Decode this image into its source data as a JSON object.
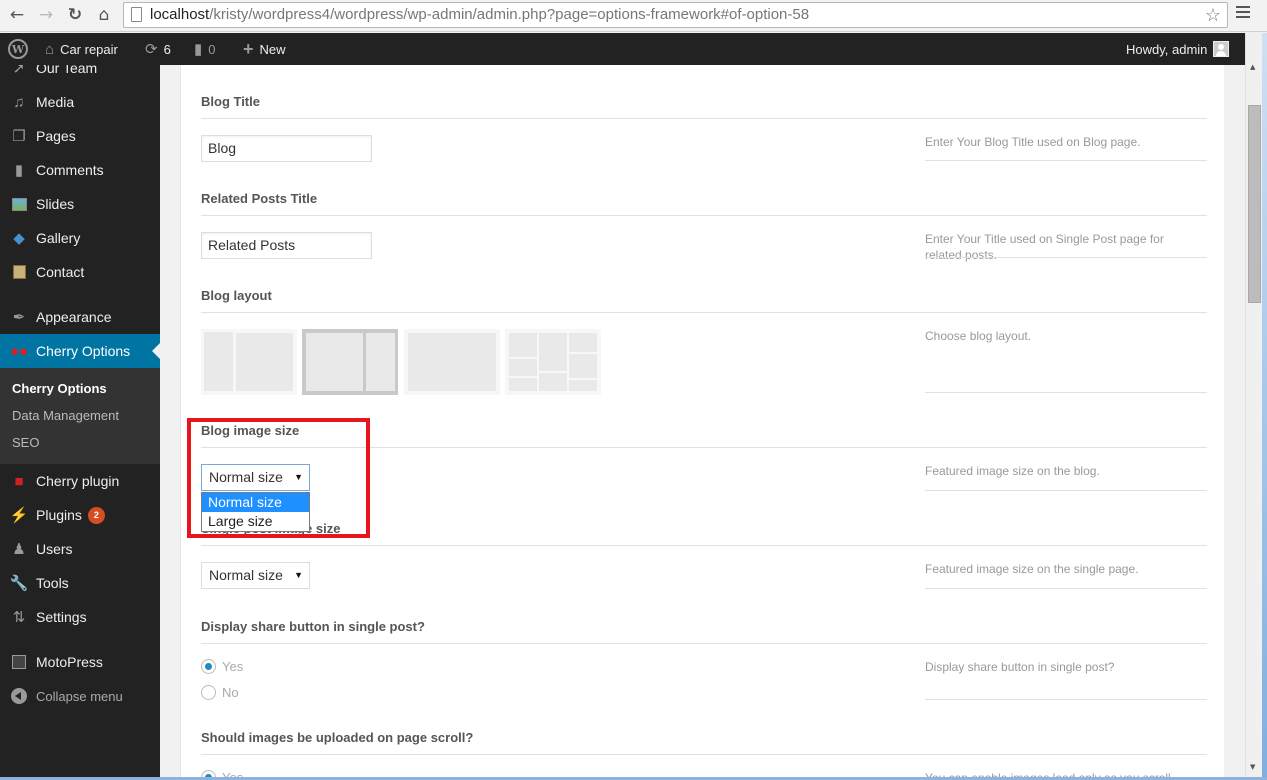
{
  "browser": {
    "url_host": "localhost",
    "url_rest": "/kristy/wordpress4/wordpress/wp-admin/admin.php?page=options-framework#of-option-58",
    "back_icon": "arrow-left",
    "forward_icon": "arrow-right",
    "reload_icon": "reload",
    "home_icon": "home",
    "bookmark_icon": "star-outline"
  },
  "adminbar": {
    "site_name": "Car repair",
    "updates_count": "6",
    "comments_count": "0",
    "new_label": "New",
    "greeting": "Howdy, admin"
  },
  "sidebar": {
    "items": [
      {
        "label": "Our Team",
        "icon": "pin"
      },
      {
        "label": "Media",
        "icon": "media"
      },
      {
        "label": "Pages",
        "icon": "pages"
      },
      {
        "label": "Comments",
        "icon": "comment"
      },
      {
        "label": "Slides",
        "icon": "slides"
      },
      {
        "label": "Gallery",
        "icon": "gallery"
      },
      {
        "label": "Contact",
        "icon": "contact"
      },
      {
        "label": "Appearance",
        "icon": "brush"
      },
      {
        "label": "Cherry Options",
        "icon": "cherry",
        "active": true
      },
      {
        "label": "Cherry plugin",
        "icon": "puzzle"
      },
      {
        "label": "Plugins",
        "icon": "plug",
        "badge": "2"
      },
      {
        "label": "Users",
        "icon": "user"
      },
      {
        "label": "Tools",
        "icon": "wrench"
      },
      {
        "label": "Settings",
        "icon": "sliders"
      },
      {
        "label": "MotoPress",
        "icon": "motopress"
      },
      {
        "label": "Collapse menu",
        "icon": "collapse"
      }
    ],
    "submenu": [
      {
        "label": "Cherry Options",
        "current": true
      },
      {
        "label": "Data Management"
      },
      {
        "label": "SEO"
      }
    ]
  },
  "options": {
    "blog_title": {
      "title": "Blog Title",
      "value": "Blog",
      "desc": "Enter Your Blog Title used on Blog page."
    },
    "related_posts_title": {
      "title": "Related Posts Title",
      "value": "Related Posts",
      "desc": "Enter Your Title used on Single Post page for related posts."
    },
    "blog_layout": {
      "title": "Blog layout",
      "desc": "Choose blog layout.",
      "options": [
        "sidebar-left",
        "sidebar-right",
        "full-width",
        "masonry"
      ],
      "selected": "sidebar-right"
    },
    "blog_image_size": {
      "title": "Blog image size",
      "value": "Normal size",
      "desc": "Featured image size on the blog.",
      "dropdown_open": true,
      "dropdown_options": [
        "Normal size",
        "Large size"
      ],
      "highlighted": "Normal size"
    },
    "single_image_size": {
      "title": "Single post image size",
      "value": "Normal size",
      "desc": "Featured image size on the single page."
    },
    "share_button": {
      "title": "Display share button in single post?",
      "desc": "Display share button in single post?",
      "radios": [
        {
          "label": "Yes",
          "checked": true
        },
        {
          "label": "No",
          "checked": false
        }
      ]
    },
    "lazy_load": {
      "title": "Should images be uploaded on page scroll?",
      "desc": "You can enable images load only as you scroll",
      "radio_first": "Yes"
    }
  },
  "annotation": {
    "highlight_color": "#e8141e"
  },
  "colors": {
    "admin_bar": "#222222",
    "active_menu": "#0074a2",
    "badge": "#d54e21",
    "dropdown_highlight": "#1e90ff"
  }
}
